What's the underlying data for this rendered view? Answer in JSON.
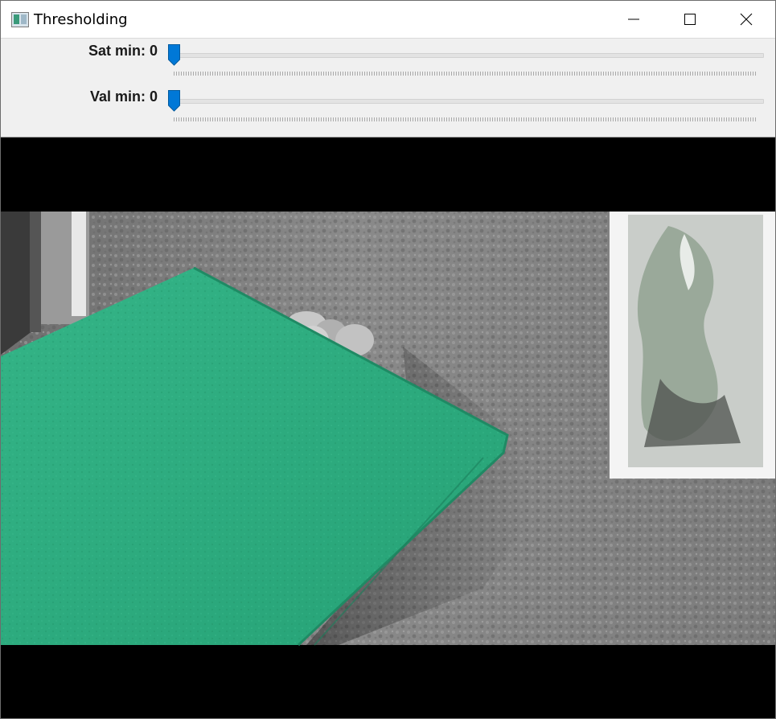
{
  "window": {
    "title": "Thresholding",
    "icon": "opencv-window-icon",
    "buttons": [
      "minimize-icon",
      "maximize-icon",
      "close-icon"
    ]
  },
  "trackbars": [
    {
      "label": "Sat min: 0",
      "value": 0,
      "min": 0
    },
    {
      "label": "Val min: 0",
      "value": 0,
      "min": 0
    }
  ],
  "colors": {
    "slider_thumb": "#0078d7",
    "green_folder": "#2dab7f",
    "letterbox": "#000000"
  }
}
